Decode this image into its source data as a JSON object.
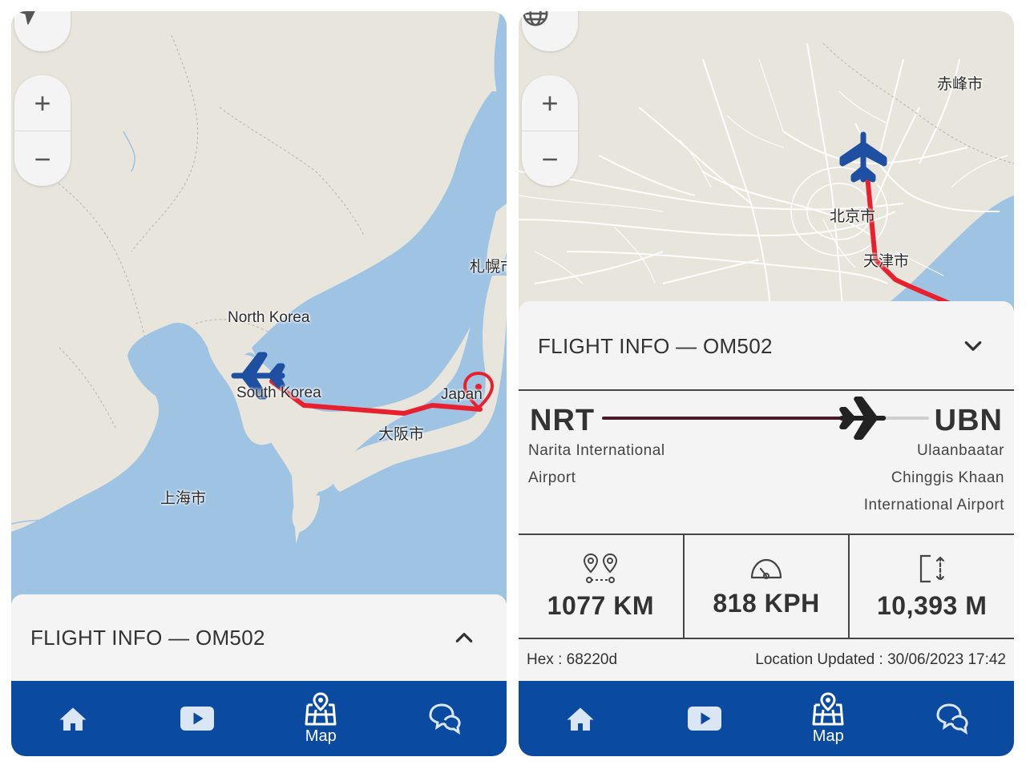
{
  "left": {
    "map_labels": {
      "north_korea": "North Korea",
      "south_korea": "South Korea",
      "japan": "Japan",
      "osaka": "大阪市",
      "shanghai": "上海市",
      "sapporo": "札幌市"
    },
    "zoom_in": "+",
    "zoom_out": "−",
    "info_title": "FLIGHT INFO — OM502"
  },
  "right": {
    "map_labels": {
      "chifeng": "赤峰市",
      "beijing": "北京市",
      "tianjin": "天津市"
    },
    "zoom_in": "+",
    "zoom_out": "−",
    "info_title": "FLIGHT INFO — OM502",
    "origin": {
      "code": "NRT",
      "name_lines": [
        "Narita International",
        "Airport"
      ]
    },
    "destination": {
      "code": "UBN",
      "name_lines": [
        "Ulaanbaatar",
        "Chinggis Khaan",
        "International Airport"
      ]
    },
    "progress": 0.8,
    "stats": {
      "distance": "1077 KM",
      "speed": "818 KPH",
      "altitude": "10,393 M"
    },
    "hex": "Hex : 68220d",
    "location_updated": "Location Updated : 30/06/2023 17:42"
  },
  "nav": {
    "map_label": "Map",
    "items": [
      "home-icon",
      "video-icon",
      "map-icon",
      "chat-icon"
    ]
  },
  "colors": {
    "water": "#9ec3e3",
    "land": "#e8e5dd",
    "route": "#e8202e",
    "plane": "#1e4fa0",
    "nav": "#0a4aa0",
    "progress_done": "#4a1a2a",
    "progress_rest": "#cfcfcf"
  }
}
